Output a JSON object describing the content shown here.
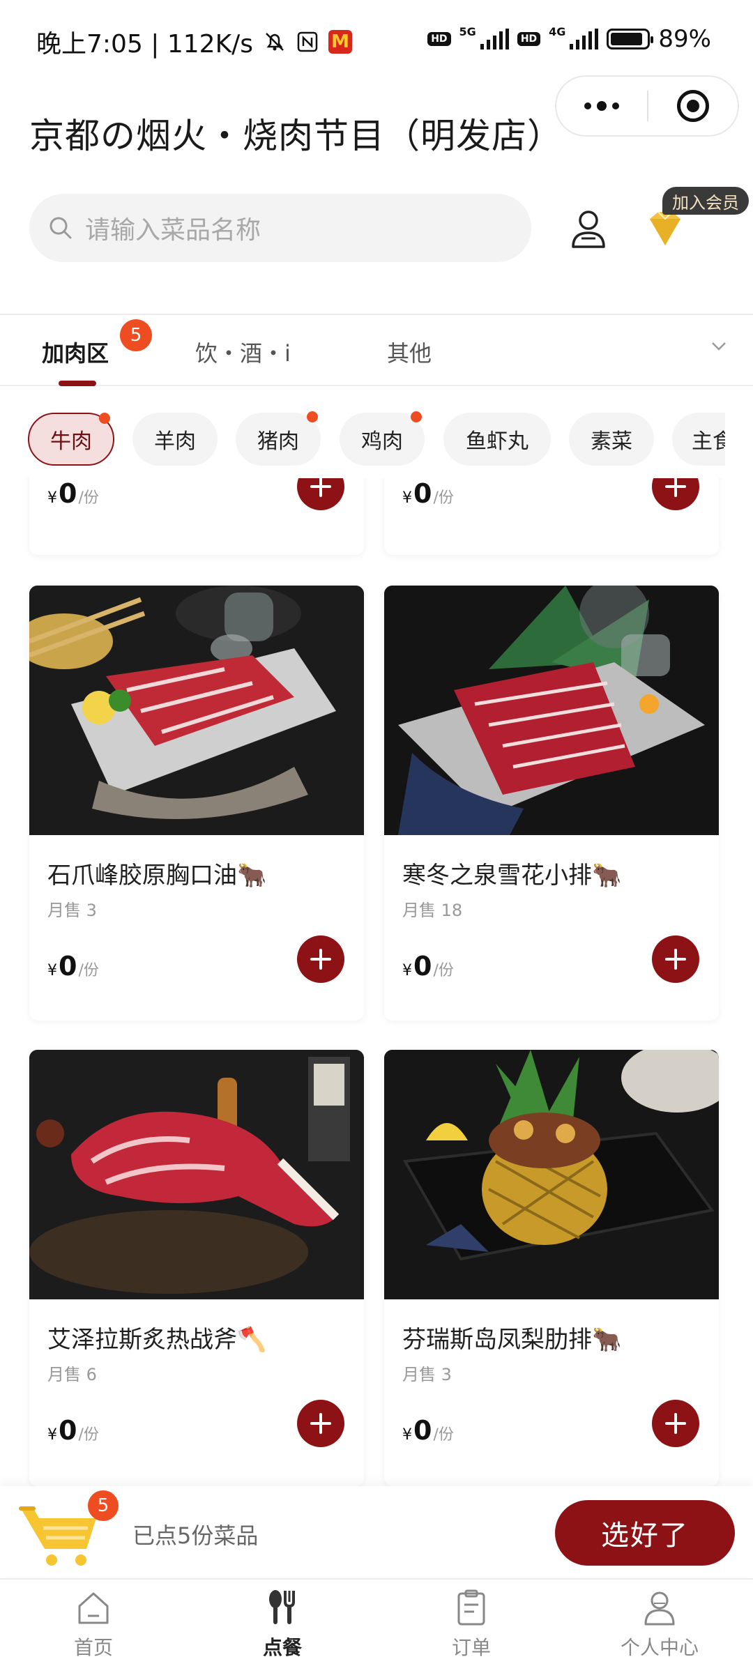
{
  "status_bar": {
    "time": "晚上7:05 | 112K/s",
    "battery": "89%",
    "battery_level": 0.89,
    "net_5g": "5G",
    "net_4g": "4G",
    "hd_label": "HD"
  },
  "header": {
    "store_title": "京都の烟火・烧肉节目（明发店）"
  },
  "search": {
    "placeholder": "请输入菜品名称"
  },
  "member": {
    "join_label": "加入会员"
  },
  "tabs": {
    "items": [
      {
        "label": "加肉区",
        "active": true
      },
      {
        "label": "饮・酒・i",
        "active": false
      },
      {
        "label": "其他",
        "active": false
      }
    ],
    "badge": "5"
  },
  "chips": {
    "items": [
      {
        "label": "牛肉",
        "active": true,
        "dot": true
      },
      {
        "label": "羊肉",
        "active": false,
        "dot": false
      },
      {
        "label": "猪肉",
        "active": false,
        "dot": true
      },
      {
        "label": "鸡肉",
        "active": false,
        "dot": true
      },
      {
        "label": "鱼虾丸",
        "active": false,
        "dot": false
      },
      {
        "label": "素菜",
        "active": false,
        "dot": false
      },
      {
        "label": "主食",
        "active": false,
        "dot": false
      }
    ]
  },
  "products": {
    "currency": "¥",
    "unit": "/份",
    "top_row": [
      {
        "price": "0"
      },
      {
        "price": "0"
      }
    ],
    "items": [
      {
        "name": "石爪峰胶原胸口油",
        "emoji": "🐂",
        "sold": "月售 3",
        "price": "0"
      },
      {
        "name": "寒冬之泉雪花小排",
        "emoji": "🐂",
        "sold": "月售 18",
        "price": "0"
      },
      {
        "name": "艾泽拉斯炙热战斧",
        "emoji": "🪓",
        "sold": "月售 6",
        "price": "0"
      },
      {
        "name": "芬瑞斯岛凤梨肋排",
        "emoji": "🐂",
        "sold": "月售 3",
        "price": "0"
      }
    ]
  },
  "cart": {
    "badge": "5",
    "summary": "已点5份菜品",
    "checkout_label": "选好了"
  },
  "bottom_nav": {
    "items": [
      {
        "label": "首页",
        "active": false
      },
      {
        "label": "点餐",
        "active": true
      },
      {
        "label": "订单",
        "active": false
      },
      {
        "label": "个人中心",
        "active": false
      }
    ]
  },
  "colors": {
    "brand": "#8c1216",
    "badge": "#ee4d22"
  }
}
